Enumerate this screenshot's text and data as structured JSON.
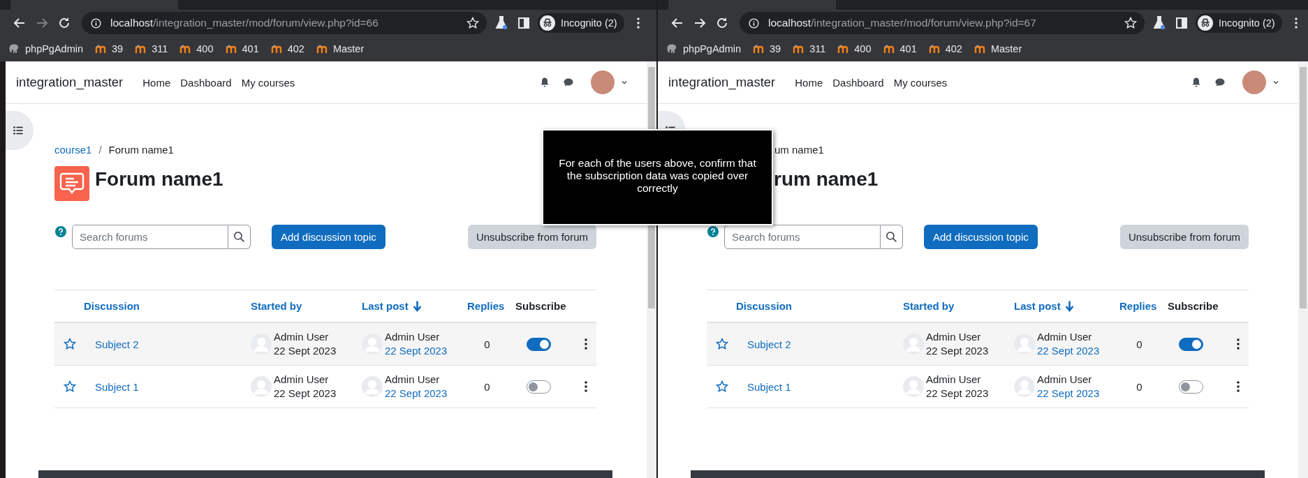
{
  "windows": [
    {
      "forward_enabled": false,
      "url_host": "localhost",
      "url_path": "/integration_master/mod/forum/view.php?id=66",
      "profile": "Incognito (2)",
      "bookmarks": [
        {
          "label": "phpPgAdmin",
          "kind": "elephant"
        },
        {
          "label": "39",
          "kind": "moodle"
        },
        {
          "label": "311",
          "kind": "moodle"
        },
        {
          "label": "400",
          "kind": "moodle"
        },
        {
          "label": "401",
          "kind": "moodle"
        },
        {
          "label": "402",
          "kind": "moodle"
        },
        {
          "label": "Master",
          "kind": "moodle"
        }
      ],
      "site_name": "integration_master",
      "nav": [
        "Home",
        "Dashboard",
        "My courses"
      ],
      "separator": "/",
      "breadcrumb": [
        {
          "label": "course1",
          "link": true
        },
        {
          "label": "Forum name1",
          "link": false
        }
      ],
      "heading_icon": true,
      "title": "Forum name1",
      "search": {
        "placeholder": "Search forums"
      },
      "add_button": "Add discussion topic",
      "unsubscribe_button": "Unsubscribe from forum",
      "columns": [
        {
          "label": "Discussion",
          "link": true,
          "sorted": false
        },
        {
          "label": "Started by",
          "link": true,
          "sorted": false
        },
        {
          "label": "Last post",
          "link": true,
          "sorted": true
        },
        {
          "label": "Replies",
          "link": true,
          "sorted": false
        },
        {
          "label": "Subscribe",
          "link": false,
          "sorted": false
        }
      ],
      "rows": [
        {
          "starred": false,
          "subject": "Subject 2",
          "started_by": "Admin User",
          "started_date": "22 Sept 2023",
          "last_by": "Admin User",
          "last_date": "22 Sept 2023",
          "replies": "0",
          "subscribed": true
        },
        {
          "starred": false,
          "subject": "Subject 1",
          "started_by": "Admin User",
          "started_date": "22 Sept 2023",
          "last_by": "Admin User",
          "last_date": "22 Sept 2023",
          "replies": "0",
          "subscribed": false
        }
      ]
    },
    {
      "forward_enabled": true,
      "url_host": "localhost",
      "url_path": "/integration_master/mod/forum/view.php?id=67",
      "profile": "Incognito (2)",
      "bookmarks": [
        {
          "label": "phpPgAdmin",
          "kind": "elephant"
        },
        {
          "label": "39",
          "kind": "moodle"
        },
        {
          "label": "311",
          "kind": "moodle"
        },
        {
          "label": "400",
          "kind": "moodle"
        },
        {
          "label": "401",
          "kind": "moodle"
        },
        {
          "label": "402",
          "kind": "moodle"
        },
        {
          "label": "Master",
          "kind": "moodle"
        }
      ],
      "site_name": "integration_master",
      "nav": [
        "Home",
        "Dashboard",
        "My courses"
      ],
      "breadcrumb": [
        {
          "label": "um name1",
          "link": false
        }
      ],
      "heading_icon": false,
      "title": "rum name1",
      "search": {
        "placeholder": "Search forums"
      },
      "add_button": "Add discussion topic",
      "unsubscribe_button": "Unsubscribe from forum",
      "columns": [
        {
          "label": "Discussion",
          "link": true,
          "sorted": false
        },
        {
          "label": "Started by",
          "link": true,
          "sorted": false
        },
        {
          "label": "Last post",
          "link": true,
          "sorted": true
        },
        {
          "label": "Replies",
          "link": true,
          "sorted": false
        },
        {
          "label": "Subscribe",
          "link": false,
          "sorted": false
        }
      ],
      "rows": [
        {
          "starred": false,
          "subject": "Subject 2",
          "started_by": "Admin User",
          "started_date": "22 Sept 2023",
          "last_by": "Admin User",
          "last_date": "22 Sept 2023",
          "replies": "0",
          "subscribed": true
        },
        {
          "starred": false,
          "subject": "Subject 1",
          "started_by": "Admin User",
          "started_date": "22 Sept 2023",
          "last_by": "Admin User",
          "last_date": "22 Sept 2023",
          "replies": "0",
          "subscribed": false
        }
      ]
    }
  ],
  "tooltip": {
    "text": "For each of the users above, confirm that the subscription data was copied over correctly"
  }
}
